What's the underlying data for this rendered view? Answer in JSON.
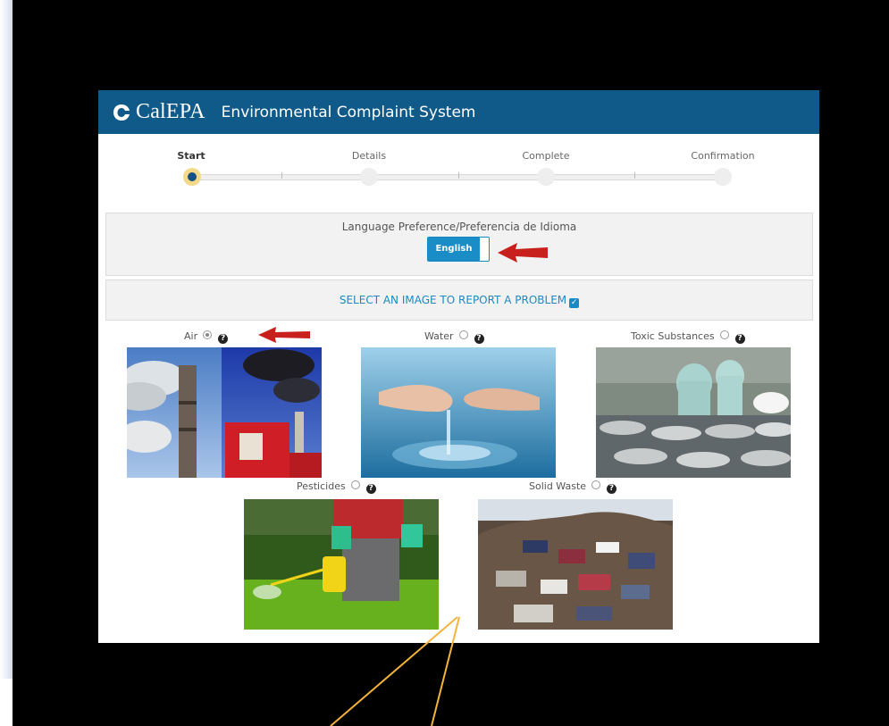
{
  "app": {
    "logo_text": "CalEPA",
    "title": "Environmental Complaint System"
  },
  "steps": [
    {
      "label": "Start",
      "active": true
    },
    {
      "label": "Details",
      "active": false
    },
    {
      "label": "Complete",
      "active": false
    },
    {
      "label": "Confirmation",
      "active": false
    }
  ],
  "language": {
    "title": "Language Preference/Preferencia de Idioma",
    "selected": "English"
  },
  "select_prompt": "SELECT AN IMAGE TO REPORT A PROBLEM",
  "categories": [
    {
      "label": "Air",
      "selected": true,
      "image": "smokestacks-photo"
    },
    {
      "label": "Water",
      "selected": false,
      "image": "water-hands-photo"
    },
    {
      "label": "Toxic Substances",
      "selected": false,
      "image": "hazmat-barrels-photo"
    },
    {
      "label": "Pesticides",
      "selected": false,
      "image": "pesticide-sprayer-photo"
    },
    {
      "label": "Solid Waste",
      "selected": false,
      "image": "trash-pile-photo"
    }
  ],
  "colors": {
    "header_bg": "#0f5a89",
    "accent": "#1b8dc6",
    "annotation_arrow": "#c8201c",
    "annotation_lines": "#f3b33d"
  }
}
